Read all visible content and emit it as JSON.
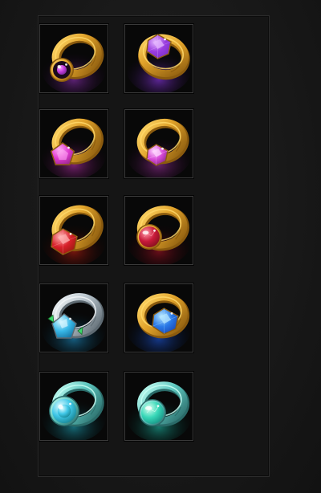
{
  "inventory": {
    "items": [
      {
        "icon": "gold-ring-dark-purple-gem-icon",
        "metal": "#e0a22a",
        "metal_light": "#ffd86a",
        "metal_dark": "#8a5a0e",
        "gem": "#c03ad8",
        "gem_light": "#f3a4ff",
        "glow": "#7a2a9a"
      },
      {
        "icon": "gold-ring-purple-crystal-icon",
        "metal": "#e0a22a",
        "metal_light": "#ffd86a",
        "metal_dark": "#8a5a0e",
        "gem": "#9a3ce0",
        "gem_light": "#e6b8ff",
        "glow": "#7a30c8"
      },
      {
        "icon": "gold-ring-magenta-pentagon-gem-icon",
        "metal": "#e0a22a",
        "metal_light": "#ffd86a",
        "metal_dark": "#8a5a0e",
        "gem": "#e03ad0",
        "gem_light": "#ffb0f4",
        "glow": "#a02a94"
      },
      {
        "icon": "gold-ring-pink-gem-icon",
        "metal": "#e0a22a",
        "metal_light": "#ffd86a",
        "metal_dark": "#8a5a0e",
        "gem": "#d84ad8",
        "gem_light": "#ffd6ff",
        "glow": "#8a2a8a"
      },
      {
        "icon": "gold-ring-red-crystal-icon",
        "metal": "#e0a22a",
        "metal_light": "#ffd86a",
        "metal_dark": "#8a5a0e",
        "gem": "#d8202a",
        "gem_light": "#ffb4b4",
        "glow": "#9a1a10"
      },
      {
        "icon": "gold-ring-red-orb-icon",
        "metal": "#e0a22a",
        "metal_light": "#ffd86a",
        "metal_dark": "#8a5a0e",
        "gem": "#c81a3a",
        "gem_light": "#ff9aa8",
        "glow": "#8a1020"
      },
      {
        "icon": "silver-ring-blue-diamond-icon",
        "metal": "#b8c4cc",
        "metal_light": "#f2f6f8",
        "metal_dark": "#5e6a72",
        "gem": "#38b8e8",
        "gem_light": "#d8f6ff",
        "glow": "#1a7aa8"
      },
      {
        "icon": "gold-ring-blue-crystal-icon",
        "metal": "#e0a22a",
        "metal_light": "#ffd86a",
        "metal_dark": "#8a5a0e",
        "gem": "#2a7ae8",
        "gem_light": "#b8e8ff",
        "glow": "#1a4ab8"
      },
      {
        "icon": "teal-ring-cyan-gem-icon",
        "metal": "#5ec8c0",
        "metal_light": "#c8fff4",
        "metal_dark": "#2a6a68",
        "gem": "#40c8e8",
        "gem_light": "#e0fcff",
        "glow": "#1a8a9a"
      },
      {
        "icon": "teal-ring-green-orb-icon",
        "metal": "#5ec8c0",
        "metal_light": "#c8fff4",
        "metal_dark": "#2a6a68",
        "gem": "#38d8b8",
        "gem_light": "#d8fff0",
        "glow": "#1a9a8a"
      }
    ]
  }
}
